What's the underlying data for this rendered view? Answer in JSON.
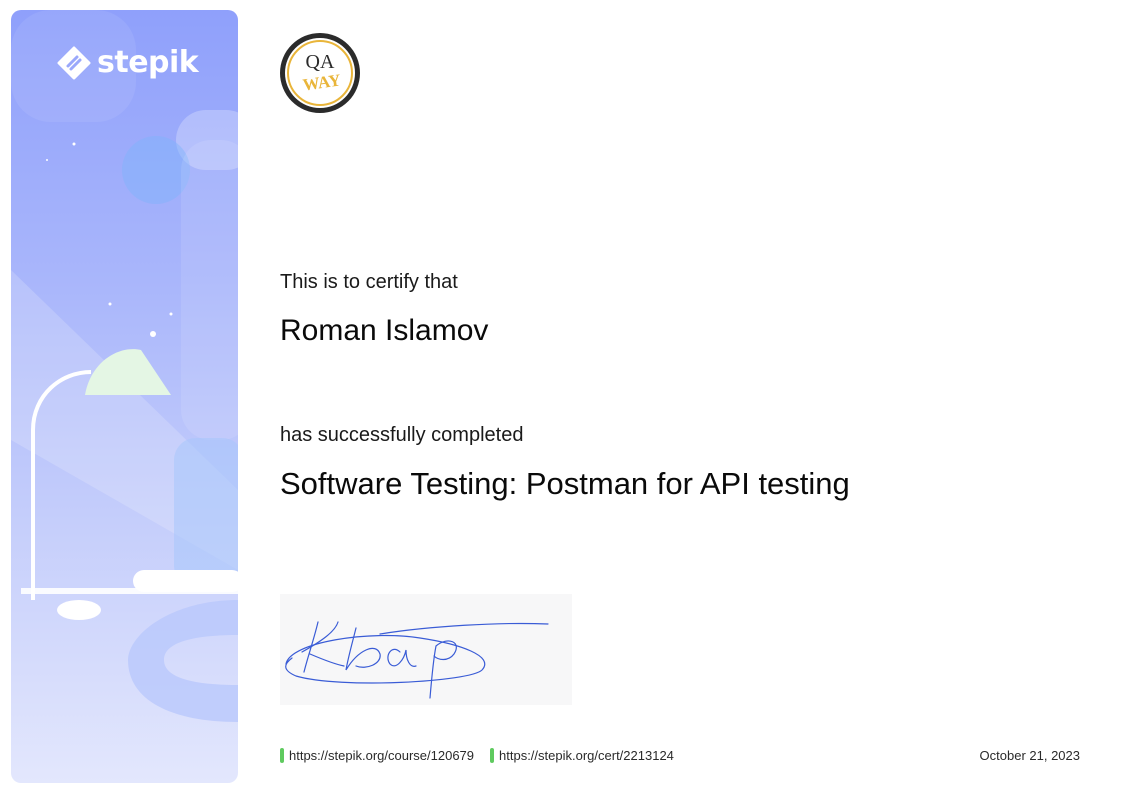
{
  "brand": {
    "platform_name": "stepik",
    "partner_logo_lines": [
      "QA",
      "WAY"
    ]
  },
  "certificate": {
    "intro": "This is to certify that",
    "recipient": "Roman Islamov",
    "completed_text": "has successfully completed",
    "course_title": "Software Testing: Postman for API testing",
    "date": "October 21, 2023"
  },
  "footer": {
    "course_url": "https://stepik.org/course/120679",
    "cert_url": "https://stepik.org/cert/2213124"
  },
  "colors": {
    "panel_top": "#8fa0fb",
    "panel_bottom": "#e3e7fd",
    "link_marker": "#5fca5f",
    "signature_ink": "#3a5cd6",
    "qa_logo_ring": "#e9b53a",
    "qa_logo_bg": "#2b2b2b"
  }
}
